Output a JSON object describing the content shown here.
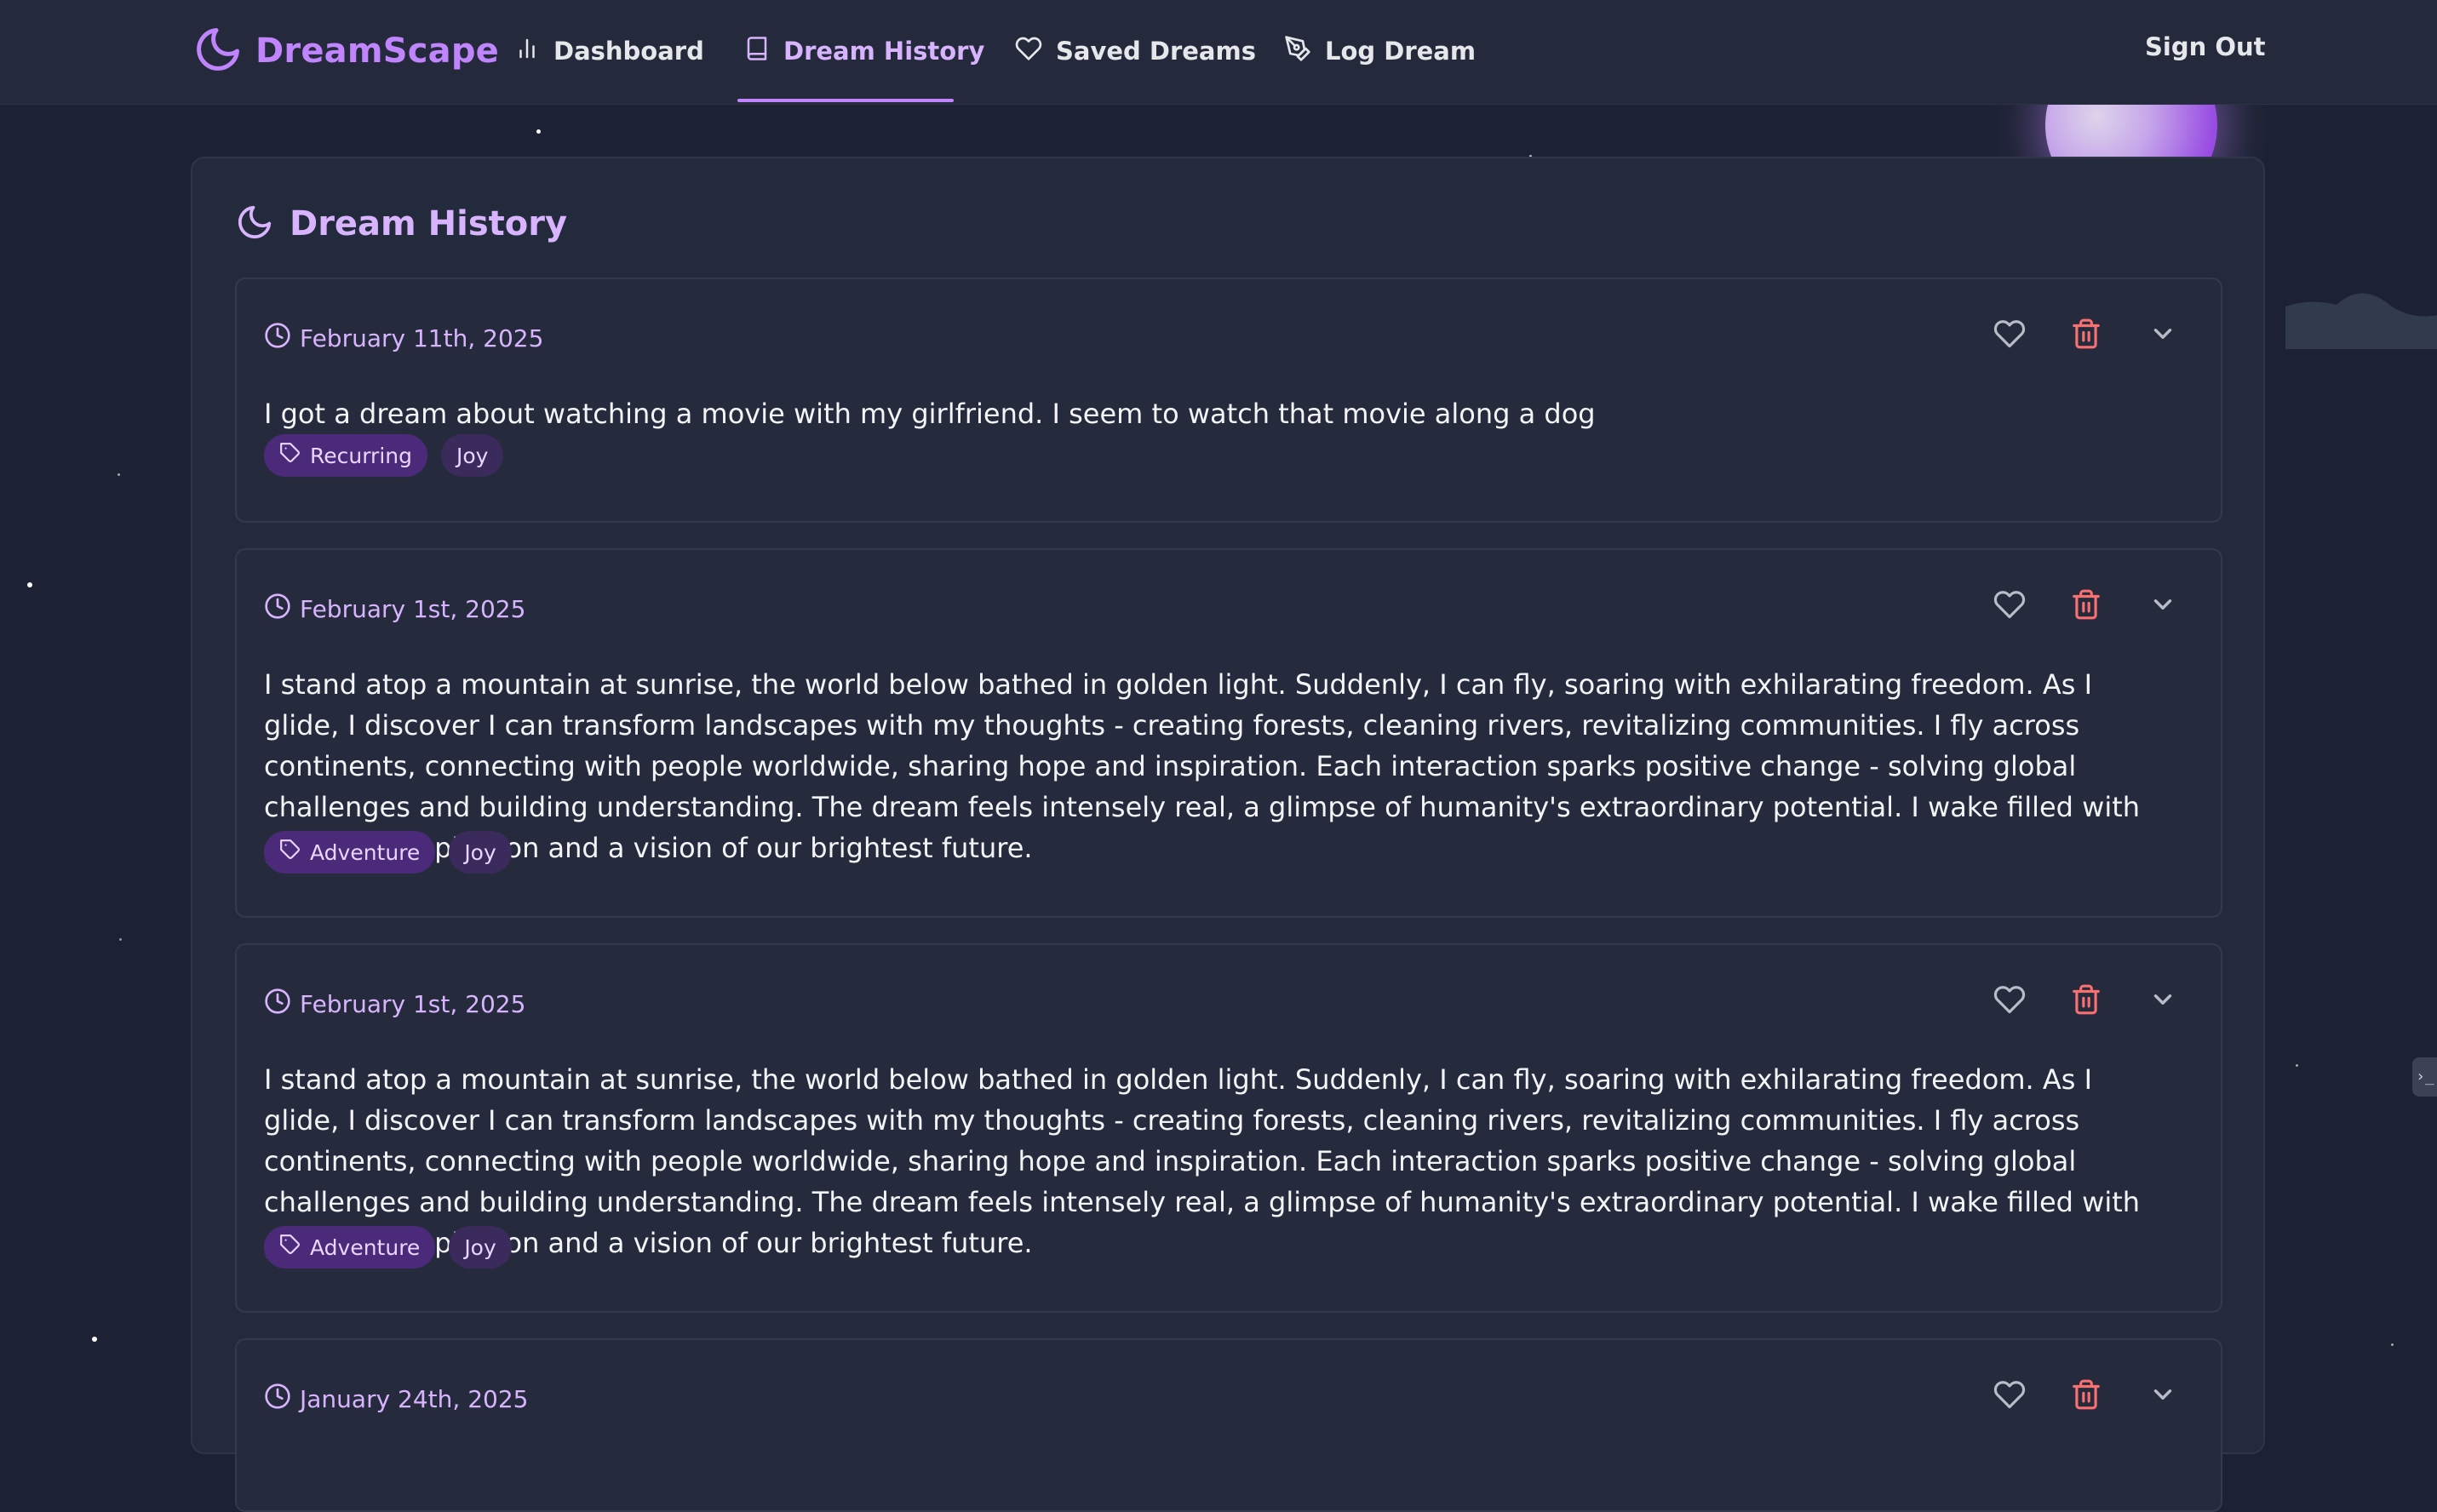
{
  "brand": {
    "name": "DreamScape",
    "accent_color": "#c084fc",
    "icon": "moon-icon"
  },
  "nav": {
    "items": [
      {
        "label": "Dashboard",
        "icon": "bar-chart-icon",
        "active": false
      },
      {
        "label": "Dream History",
        "icon": "book-icon",
        "active": true
      },
      {
        "label": "Saved Dreams",
        "icon": "heart-icon",
        "active": false
      },
      {
        "label": "Log Dream",
        "icon": "pen-tool-icon",
        "active": false
      }
    ],
    "sign_out": "Sign Out"
  },
  "page": {
    "title": "Dream History",
    "title_icon": "moon-icon"
  },
  "dreams": [
    {
      "date": "February 11th, 2025",
      "text": "I got a dream about watching a movie with my girlfriend. I seem to watch that movie along a dog",
      "tags": [
        "Recurring",
        "Joy"
      ]
    },
    {
      "date": "February 1st, 2025",
      "text": "I stand atop a mountain at sunrise, the world below bathed in golden light. Suddenly, I can fly, soaring with exhilarating freedom. As I glide, I discover I can transform landscapes with my thoughts - creating forests, cleaning rivers, revitalizing communities. I fly across continents, connecting with people worldwide, sharing hope and inspiration. Each interaction sparks positive change - solving global challenges and building understanding. The dream feels intensely real, a glimpse of humanity's extraordinary potential. I wake filled with profound inspiration and a vision of our brightest future.",
      "tags": [
        "Adventure",
        "Joy"
      ]
    },
    {
      "date": "February 1st, 2025",
      "text": "I stand atop a mountain at sunrise, the world below bathed in golden light. Suddenly, I can fly, soaring with exhilarating freedom. As I glide, I discover I can transform landscapes with my thoughts - creating forests, cleaning rivers, revitalizing communities. I fly across continents, connecting with people worldwide, sharing hope and inspiration. Each interaction sparks positive change - solving global challenges and building understanding. The dream feels intensely real, a glimpse of humanity's extraordinary potential. I wake filled with profound inspiration and a vision of our brightest future.",
      "tags": [
        "Adventure",
        "Joy"
      ]
    },
    {
      "date": "January 24th, 2025",
      "text": "",
      "tags": []
    }
  ],
  "colors": {
    "background": "#1c2233",
    "delete": "#f87171",
    "tag_primary": "#4c2a7a",
    "tag_secondary": "#3b2a5c"
  }
}
